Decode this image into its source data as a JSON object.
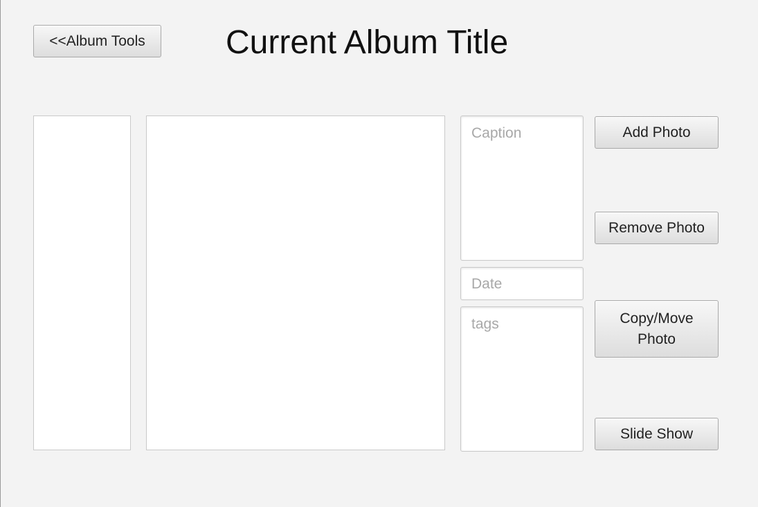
{
  "header": {
    "back_button_label": "<<Album Tools",
    "title": "Current Album Title"
  },
  "details": {
    "caption_placeholder": "Caption",
    "date_placeholder": "Date",
    "tags_placeholder": "tags"
  },
  "actions": {
    "add_photo_label": "Add Photo",
    "remove_photo_label": "Remove Photo",
    "copy_move_photo_label": "Copy/Move Photo",
    "slide_show_label": "Slide Show"
  },
  "colors": {
    "window_background": "#f3f3f3",
    "panel_background": "#ffffff",
    "placeholder_text": "#a8a8a8"
  }
}
